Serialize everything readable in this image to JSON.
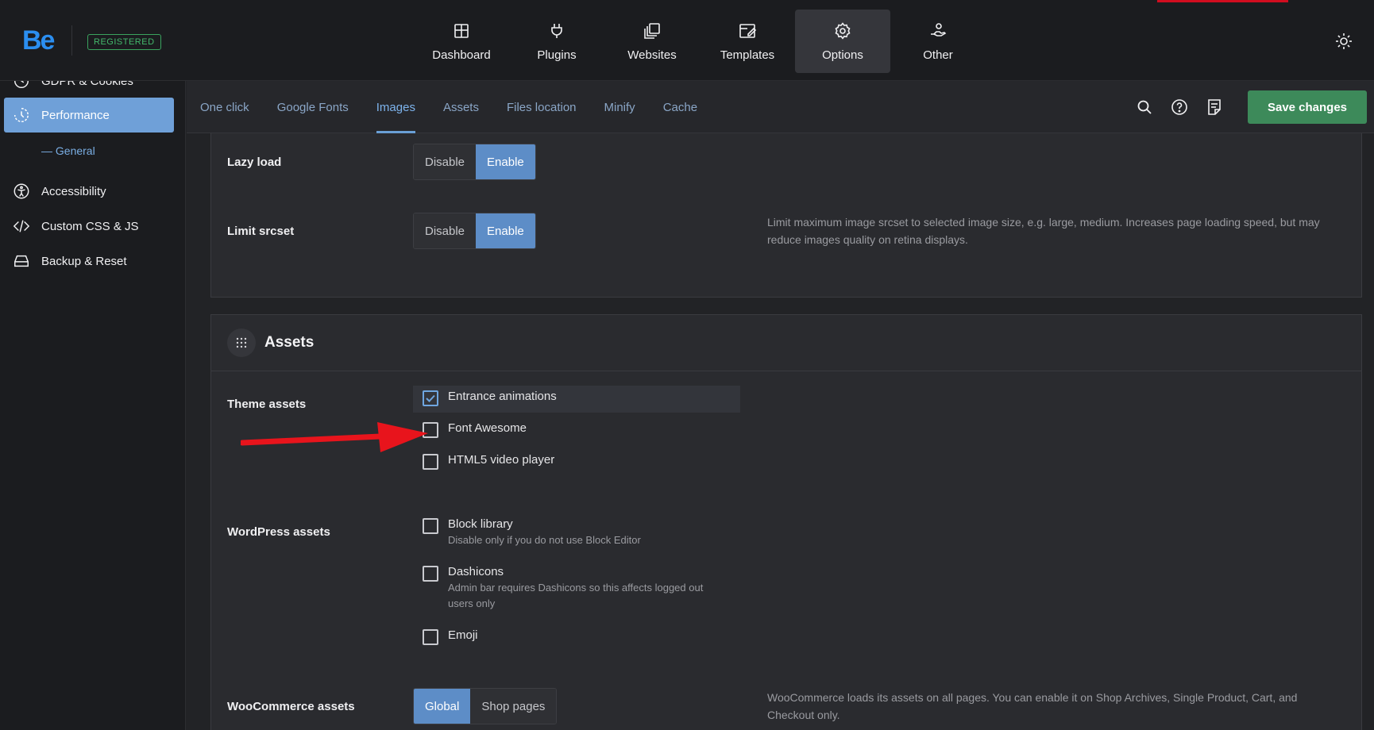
{
  "header": {
    "logo": "Be",
    "badge": "REGISTERED",
    "nav": [
      {
        "label": "Dashboard",
        "icon": "dashboard-icon"
      },
      {
        "label": "Plugins",
        "icon": "plug-icon"
      },
      {
        "label": "Websites",
        "icon": "websites-icon"
      },
      {
        "label": "Templates",
        "icon": "templates-icon"
      },
      {
        "label": "Options",
        "icon": "gear-icon",
        "active": true
      },
      {
        "label": "Other",
        "icon": "hand-user-icon"
      }
    ]
  },
  "sidebar": {
    "items": [
      {
        "label": "GDPR & Cookies",
        "icon": "gdpr-icon"
      },
      {
        "label": "Performance",
        "icon": "performance-icon",
        "active": true
      },
      {
        "label": "Accessibility",
        "icon": "accessibility-icon"
      },
      {
        "label": "Custom CSS & JS",
        "icon": "code-icon"
      },
      {
        "label": "Backup & Reset",
        "icon": "drive-icon"
      }
    ],
    "sub_item": "General"
  },
  "tabs": [
    "One click",
    "Google Fonts",
    "Images",
    "Assets",
    "Files location",
    "Minify",
    "Cache"
  ],
  "active_tab": "Images",
  "toolbar": {
    "save_label": "Save changes"
  },
  "images_panel": {
    "lazy_load": {
      "label": "Lazy load",
      "options": [
        "Disable",
        "Enable"
      ],
      "selected": "Enable"
    },
    "limit_srcset": {
      "label": "Limit srcset",
      "options": [
        "Disable",
        "Enable"
      ],
      "selected": "Enable",
      "description": "Limit maximum image srcset to selected image size, e.g. large, medium. Increases page loading speed, but may reduce images quality on retina displays."
    }
  },
  "assets_panel": {
    "title": "Assets",
    "theme_assets": {
      "label": "Theme assets",
      "items": [
        {
          "label": "Entrance animations",
          "checked": true
        },
        {
          "label": "Font Awesome",
          "checked": false
        },
        {
          "label": "HTML5 video player",
          "checked": false
        }
      ]
    },
    "wordpress_assets": {
      "label": "WordPress assets",
      "items": [
        {
          "label": "Block library",
          "note": "Disable only if you do not use Block Editor",
          "checked": false
        },
        {
          "label": "Dashicons",
          "note": "Admin bar requires Dashicons so this affects logged out users only",
          "checked": false
        },
        {
          "label": "Emoji",
          "checked": false
        }
      ]
    },
    "woocommerce_assets": {
      "label": "WooCommerce assets",
      "options": [
        "Global",
        "Shop pages"
      ],
      "selected": "Global",
      "description": "WooCommerce loads its assets on all pages. You can enable it on Shop Archives, Single Product, Cart, and Checkout only."
    }
  },
  "colors": {
    "accent": "#5d8dc7",
    "save": "#3d8a5a",
    "arrow": "#e8141c",
    "badge": "#44b86c"
  }
}
